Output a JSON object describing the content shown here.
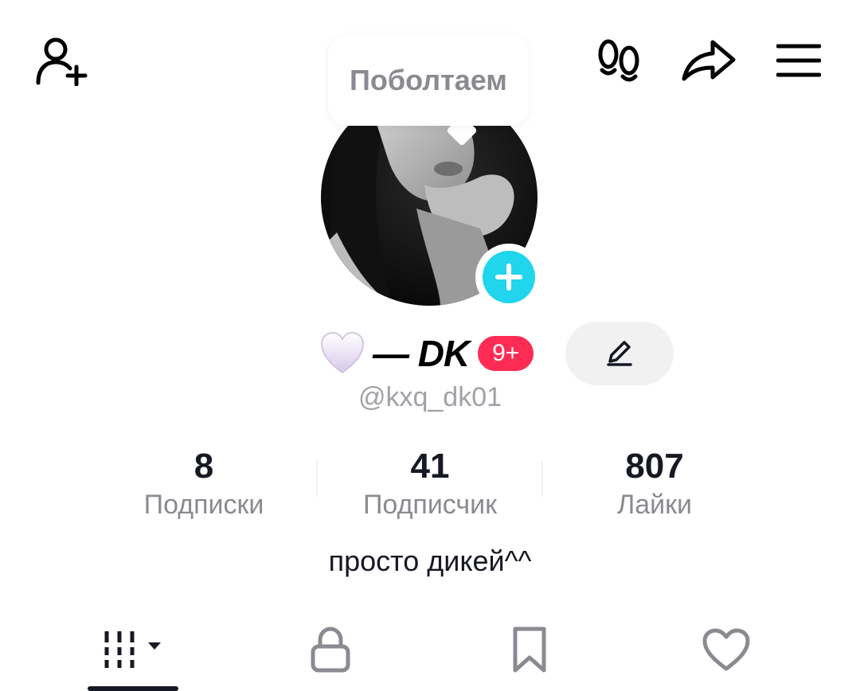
{
  "header": {
    "add_friend_icon": "person-plus-icon",
    "footprints_icon": "footprints-icon",
    "share_icon": "share-arrow-icon",
    "menu_icon": "hamburger-menu-icon"
  },
  "chat_bubble": {
    "text": "Поболтаем"
  },
  "profile": {
    "emoji": "white-heart",
    "nickname": "— DK",
    "notification_badge": "9+",
    "username": "@kxq_dk01",
    "bio": "просто дикей^^"
  },
  "stats": [
    {
      "value": "8",
      "label": "Подписки"
    },
    {
      "value": "41",
      "label": "Подписчик"
    },
    {
      "value": "807",
      "label": "Лайки"
    }
  ],
  "tabs": [
    {
      "icon": "videos-grid-icon",
      "active": true
    },
    {
      "icon": "lock-icon",
      "active": false
    },
    {
      "icon": "bookmark-icon",
      "active": false
    },
    {
      "icon": "heart-outline-icon",
      "active": false
    }
  ],
  "colors": {
    "accent_cyan": "#20d5ec",
    "badge_red": "#fe2c55",
    "text_primary": "#161823",
    "text_secondary": "#8a8b91"
  }
}
